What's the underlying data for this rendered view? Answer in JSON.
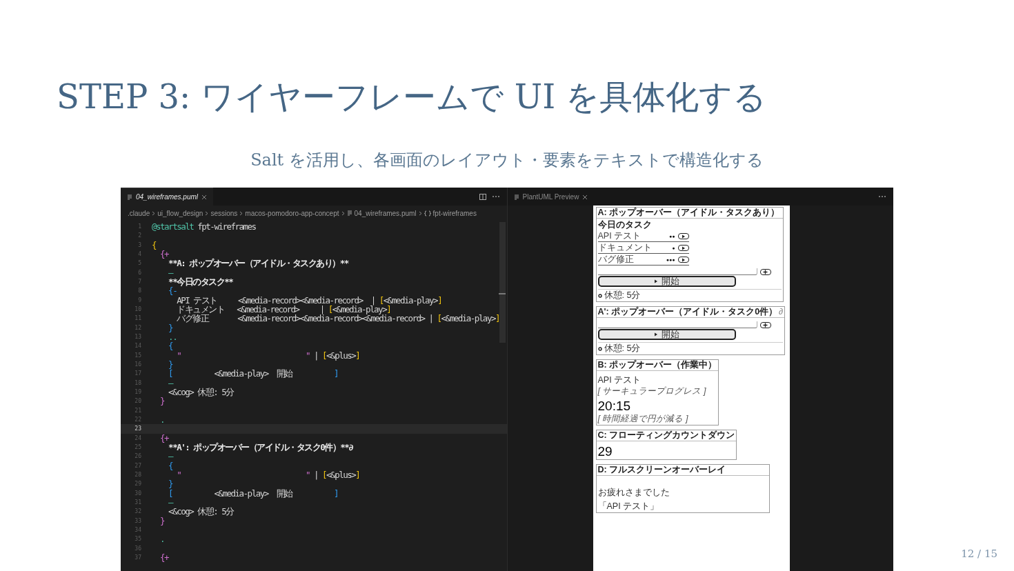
{
  "slide": {
    "title": "STEP 3: ワイヤーフレームで UI を具体化する",
    "subtitle": "Salt を活用し、各画面のレイアウト・要素をテキストで構造化する",
    "page_number": "12 / 15"
  },
  "editor": {
    "tab": {
      "label": "04_wireframes.puml",
      "selected": true
    },
    "breadcrumbs": [
      {
        "kind": "folder",
        "label": ".claude"
      },
      {
        "kind": "folder",
        "label": "ui_flow_design"
      },
      {
        "kind": "folder",
        "label": "sessions"
      },
      {
        "kind": "folder",
        "label": "macos-pomodoro-app-concept"
      },
      {
        "kind": "file",
        "label": "04_wireframes.puml"
      },
      {
        "kind": "symbol",
        "label": "fpt-wireframes"
      }
    ],
    "lines": [
      {
        "num": "1",
        "current": false,
        "segments": [
          {
            "kind": "directive",
            "text": "@startsalt"
          },
          {
            "kind": "plain",
            "text": " fpt-wireframes"
          }
        ]
      },
      {
        "num": "2",
        "current": false
      },
      {
        "num": "3",
        "current": false,
        "segments": [
          {
            "kind": "bracket1",
            "text": "{"
          }
        ]
      },
      {
        "num": "4",
        "current": false,
        "segments": [
          {
            "kind": "bracket2",
            "text": "  {+"
          }
        ]
      },
      {
        "num": "5",
        "current": false,
        "segments": [
          {
            "kind": "bold",
            "text": "    **A: ポップオーバー（アイドル・タスクあり）**"
          }
        ]
      },
      {
        "num": "6",
        "current": false,
        "segments": [
          {
            "kind": "operator",
            "text": "    —"
          }
        ]
      },
      {
        "num": "7",
        "current": false,
        "segments": [
          {
            "kind": "bold",
            "text": "    **今日のタスク**"
          }
        ]
      },
      {
        "num": "8",
        "current": false,
        "segments": [
          {
            "kind": "bracket3",
            "text": "    {-"
          }
        ]
      },
      {
        "num": "9",
        "current": false,
        "segments": [
          {
            "kind": "plain",
            "text": "      API テスト     <&media-record><&media-record>  | "
          },
          {
            "kind": "bracket1",
            "text": "["
          },
          {
            "kind": "plain",
            "text": "<&media-play>"
          },
          {
            "kind": "bracket1",
            "text": "]"
          }
        ]
      },
      {
        "num": "10",
        "current": false,
        "segments": [
          {
            "kind": "plain",
            "text": "      ドキュメント   <&media-record>     | "
          },
          {
            "kind": "bracket1",
            "text": "["
          },
          {
            "kind": "plain",
            "text": "<&media-play>"
          },
          {
            "kind": "bracket1",
            "text": "]"
          }
        ]
      },
      {
        "num": "11",
        "current": false,
        "segments": [
          {
            "kind": "plain",
            "text": "      バグ修正       <&media-record><&media-record><&media-record> | "
          },
          {
            "kind": "bracket1",
            "text": "["
          },
          {
            "kind": "plain",
            "text": "<&media-play>"
          },
          {
            "kind": "bracket1",
            "text": "]"
          }
        ]
      },
      {
        "num": "12",
        "current": false,
        "segments": [
          {
            "kind": "bracket3",
            "text": "    }"
          }
        ]
      },
      {
        "num": "13",
        "current": false,
        "segments": [
          {
            "kind": "operator",
            "text": "    .."
          }
        ]
      },
      {
        "num": "14",
        "current": false,
        "segments": [
          {
            "kind": "bracket3",
            "text": "    {"
          }
        ]
      },
      {
        "num": "15",
        "current": false,
        "segments": [
          {
            "kind": "string",
            "text": "      \"                              \""
          },
          {
            "kind": "plain",
            "text": " | "
          },
          {
            "kind": "bracket1",
            "text": "["
          },
          {
            "kind": "plain",
            "text": "<&plus>"
          },
          {
            "kind": "bracket1",
            "text": "]"
          }
        ]
      },
      {
        "num": "16",
        "current": false,
        "segments": [
          {
            "kind": "bracket3",
            "text": "    }"
          }
        ]
      },
      {
        "num": "17",
        "current": false,
        "segments": [
          {
            "kind": "bracket3",
            "text": "    ["
          },
          {
            "kind": "plain",
            "text": "          <&media-play>  開始          "
          },
          {
            "kind": "bracket3",
            "text": "]"
          }
        ]
      },
      {
        "num": "18",
        "current": false,
        "segments": [
          {
            "kind": "operator",
            "text": "    —"
          }
        ]
      },
      {
        "num": "19",
        "current": false,
        "segments": [
          {
            "kind": "plain",
            "text": "    <&cog> 休憩: 5分"
          }
        ]
      },
      {
        "num": "20",
        "current": false,
        "segments": [
          {
            "kind": "bracket2",
            "text": "  }"
          }
        ]
      },
      {
        "num": "21",
        "current": false
      },
      {
        "num": "22",
        "current": false,
        "segments": [
          {
            "kind": "operator",
            "text": "  ."
          }
        ]
      },
      {
        "num": "23",
        "current": true
      },
      {
        "num": "24",
        "current": false,
        "segments": [
          {
            "kind": "bracket2",
            "text": "  {+"
          }
        ]
      },
      {
        "num": "25",
        "current": false,
        "segments": [
          {
            "kind": "bold",
            "text": "    **A': ポップオーバー（アイドル・タスク0件）**∂"
          }
        ]
      },
      {
        "num": "26",
        "current": false,
        "segments": [
          {
            "kind": "operator",
            "text": "    —"
          }
        ]
      },
      {
        "num": "27",
        "current": false,
        "segments": [
          {
            "kind": "bracket3",
            "text": "    {"
          }
        ]
      },
      {
        "num": "28",
        "current": false,
        "segments": [
          {
            "kind": "string",
            "text": "      \"                              \""
          },
          {
            "kind": "plain",
            "text": " | "
          },
          {
            "kind": "bracket1",
            "text": "["
          },
          {
            "kind": "plain",
            "text": "<&plus>"
          },
          {
            "kind": "bracket1",
            "text": "]"
          }
        ]
      },
      {
        "num": "29",
        "current": false,
        "segments": [
          {
            "kind": "bracket3",
            "text": "    }"
          }
        ]
      },
      {
        "num": "30",
        "current": false,
        "segments": [
          {
            "kind": "bracket3",
            "text": "    ["
          },
          {
            "kind": "plain",
            "text": "          <&media-play>  開始          "
          },
          {
            "kind": "bracket3",
            "text": "]"
          }
        ]
      },
      {
        "num": "31",
        "current": false,
        "segments": [
          {
            "kind": "operator",
            "text": "    —"
          }
        ]
      },
      {
        "num": "32",
        "current": false,
        "segments": [
          {
            "kind": "plain",
            "text": "    <&cog> 休憩: 5分"
          }
        ]
      },
      {
        "num": "33",
        "current": false,
        "segments": [
          {
            "kind": "bracket2",
            "text": "  }"
          }
        ]
      },
      {
        "num": "34",
        "current": false
      },
      {
        "num": "35",
        "current": false,
        "segments": [
          {
            "kind": "operator",
            "text": "  ."
          }
        ]
      },
      {
        "num": "36",
        "current": false
      },
      {
        "num": "37",
        "current": false,
        "segments": [
          {
            "kind": "bracket2",
            "text": "  {+"
          }
        ]
      }
    ]
  },
  "preview": {
    "tab": {
      "label": "PlantUML Preview",
      "selected": false
    },
    "sections": [
      {
        "title": "A: ポップオーバー（アイドル・タスクあり）",
        "items": [
          {
            "kind": "heading",
            "text": "今日のタスク"
          },
          {
            "kind": "task",
            "text": "API テスト",
            "marks": "●●"
          },
          {
            "kind": "task",
            "text": "ドキュメント",
            "marks": "●"
          },
          {
            "kind": "task",
            "text": "バグ修正",
            "marks": "●●●"
          },
          {
            "kind": "input"
          },
          {
            "kind": "start",
            "text": "開始"
          },
          {
            "kind": "setting",
            "text": "休憩: 5分"
          }
        ]
      },
      {
        "title": "A': ポップオーバー（アイドル・タスク0件）",
        "suffix": "∂",
        "items": [
          {
            "kind": "input"
          },
          {
            "kind": "start",
            "text": "開始"
          },
          {
            "kind": "setting",
            "text": "休憩: 5分"
          }
        ]
      },
      {
        "title": "B: ポップオーバー（作業中）",
        "items": [
          {
            "kind": "text",
            "text": "API テスト"
          },
          {
            "kind": "note",
            "text": "[ サーキュラープログレス ]"
          },
          {
            "kind": "big",
            "text": "20:15"
          },
          {
            "kind": "note",
            "text": "[ 時間経過で円が減る ]"
          }
        ]
      },
      {
        "title": "C: フローティングカウントダウン",
        "items": [
          {
            "kind": "big",
            "text": "29"
          }
        ]
      },
      {
        "title": "D: フルスクリーンオーバーレイ",
        "items": [
          {
            "kind": "spacer"
          },
          {
            "kind": "text",
            "text": "お疲れさまでした"
          },
          {
            "kind": "text",
            "text": "「API テスト」"
          }
        ]
      }
    ]
  }
}
